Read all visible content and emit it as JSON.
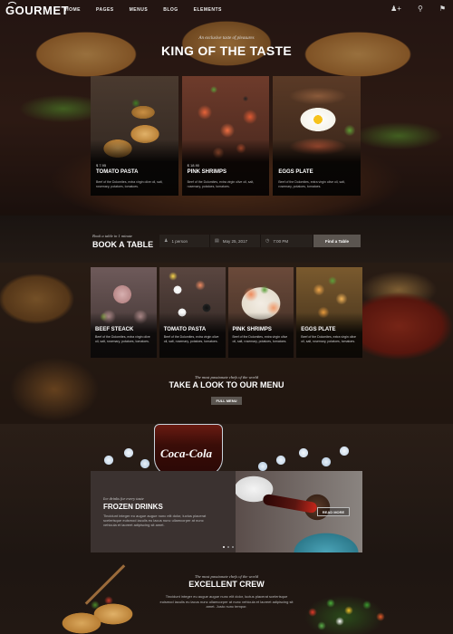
{
  "nav": {
    "logo": "GOURMET",
    "items": [
      "HOME",
      "PAGES",
      "MENUS",
      "BLOG",
      "ELEMENTS"
    ],
    "icons": [
      "user-plus-icon",
      "search-icon",
      "flag-icon"
    ]
  },
  "hero": {
    "subtitle": "An exclusive taste of pleasures",
    "title": "KING OF THE TASTE",
    "cards": [
      {
        "tag": "$ 7.95",
        "name": "TOMATO PASTA",
        "desc": "Beef of the Dolomites, extra virgin olive oil, salt, rosemary, potatoes, tomatoes."
      },
      {
        "tag": "$ 18.90",
        "name": "PINK SHRIMPS",
        "desc": "Beef of the Dolomites, extra virgin olive oil, salt, rosemary, potatoes, tomatoes."
      },
      {
        "tag": "",
        "name": "EGGS PLATE",
        "desc": "Beef of the Dolomites, extra virgin olive oil, salt, rosemary, potatoes, tomatoes."
      }
    ]
  },
  "booking": {
    "subtitle": "Book a table in 1 minute",
    "title": "BOOK A TABLE",
    "person": "1 person",
    "date": "May 25, 2017",
    "time": "7:00 PM",
    "button": "Find a Table"
  },
  "menu": {
    "cards": [
      {
        "name": "BEEF STEACK",
        "desc": "Beef of the Dolomites, extra virgin olive oil, salt, rosemary, potatoes, tomatoes."
      },
      {
        "name": "TOMATO PASTA",
        "desc": "Beef of the Dolomites, extra virgin olive oil, salt, rosemary, potatoes, tomatoes."
      },
      {
        "name": "PINK SHRIMPS",
        "desc": "Beef of the Dolomites, extra virgin olive oil, salt, rosemary, potatoes, tomatoes."
      },
      {
        "name": "EGGS PLATE",
        "desc": "Beef of the Dolomites, extra virgin olive oil, salt, rosemary, potatoes, tomatoes."
      }
    ],
    "subtitle": "The most passionate chefs of the world",
    "title": "TAKE A LOOK TO OUR MENU",
    "button": "FULL MENU"
  },
  "drinks": {
    "glass_label": "Coca-Cola",
    "subtitle": "Ice drinks for every taste",
    "title": "FROZEN DRINKS",
    "desc": "Tincidunt integer eu augue augue nunc elit dolor, luctus placerat scelerisque euismod iaculis eu lacus nunc ullamcorper at nunc vehicula et laoreet adipiscing sit amet.",
    "button": "READ MORE"
  },
  "crew": {
    "subtitle": "The most passionate chefs of the world",
    "title": "EXCELLENT CREW",
    "desc": "Tincidunt integer eu augue augue nunc elit dolor, luctus placerat scelerisque euismod iaculis eu lacus nunc ullamcorper at nunc vehicula et laoreet adipiscing sit amet. Justo nunc tempor."
  }
}
